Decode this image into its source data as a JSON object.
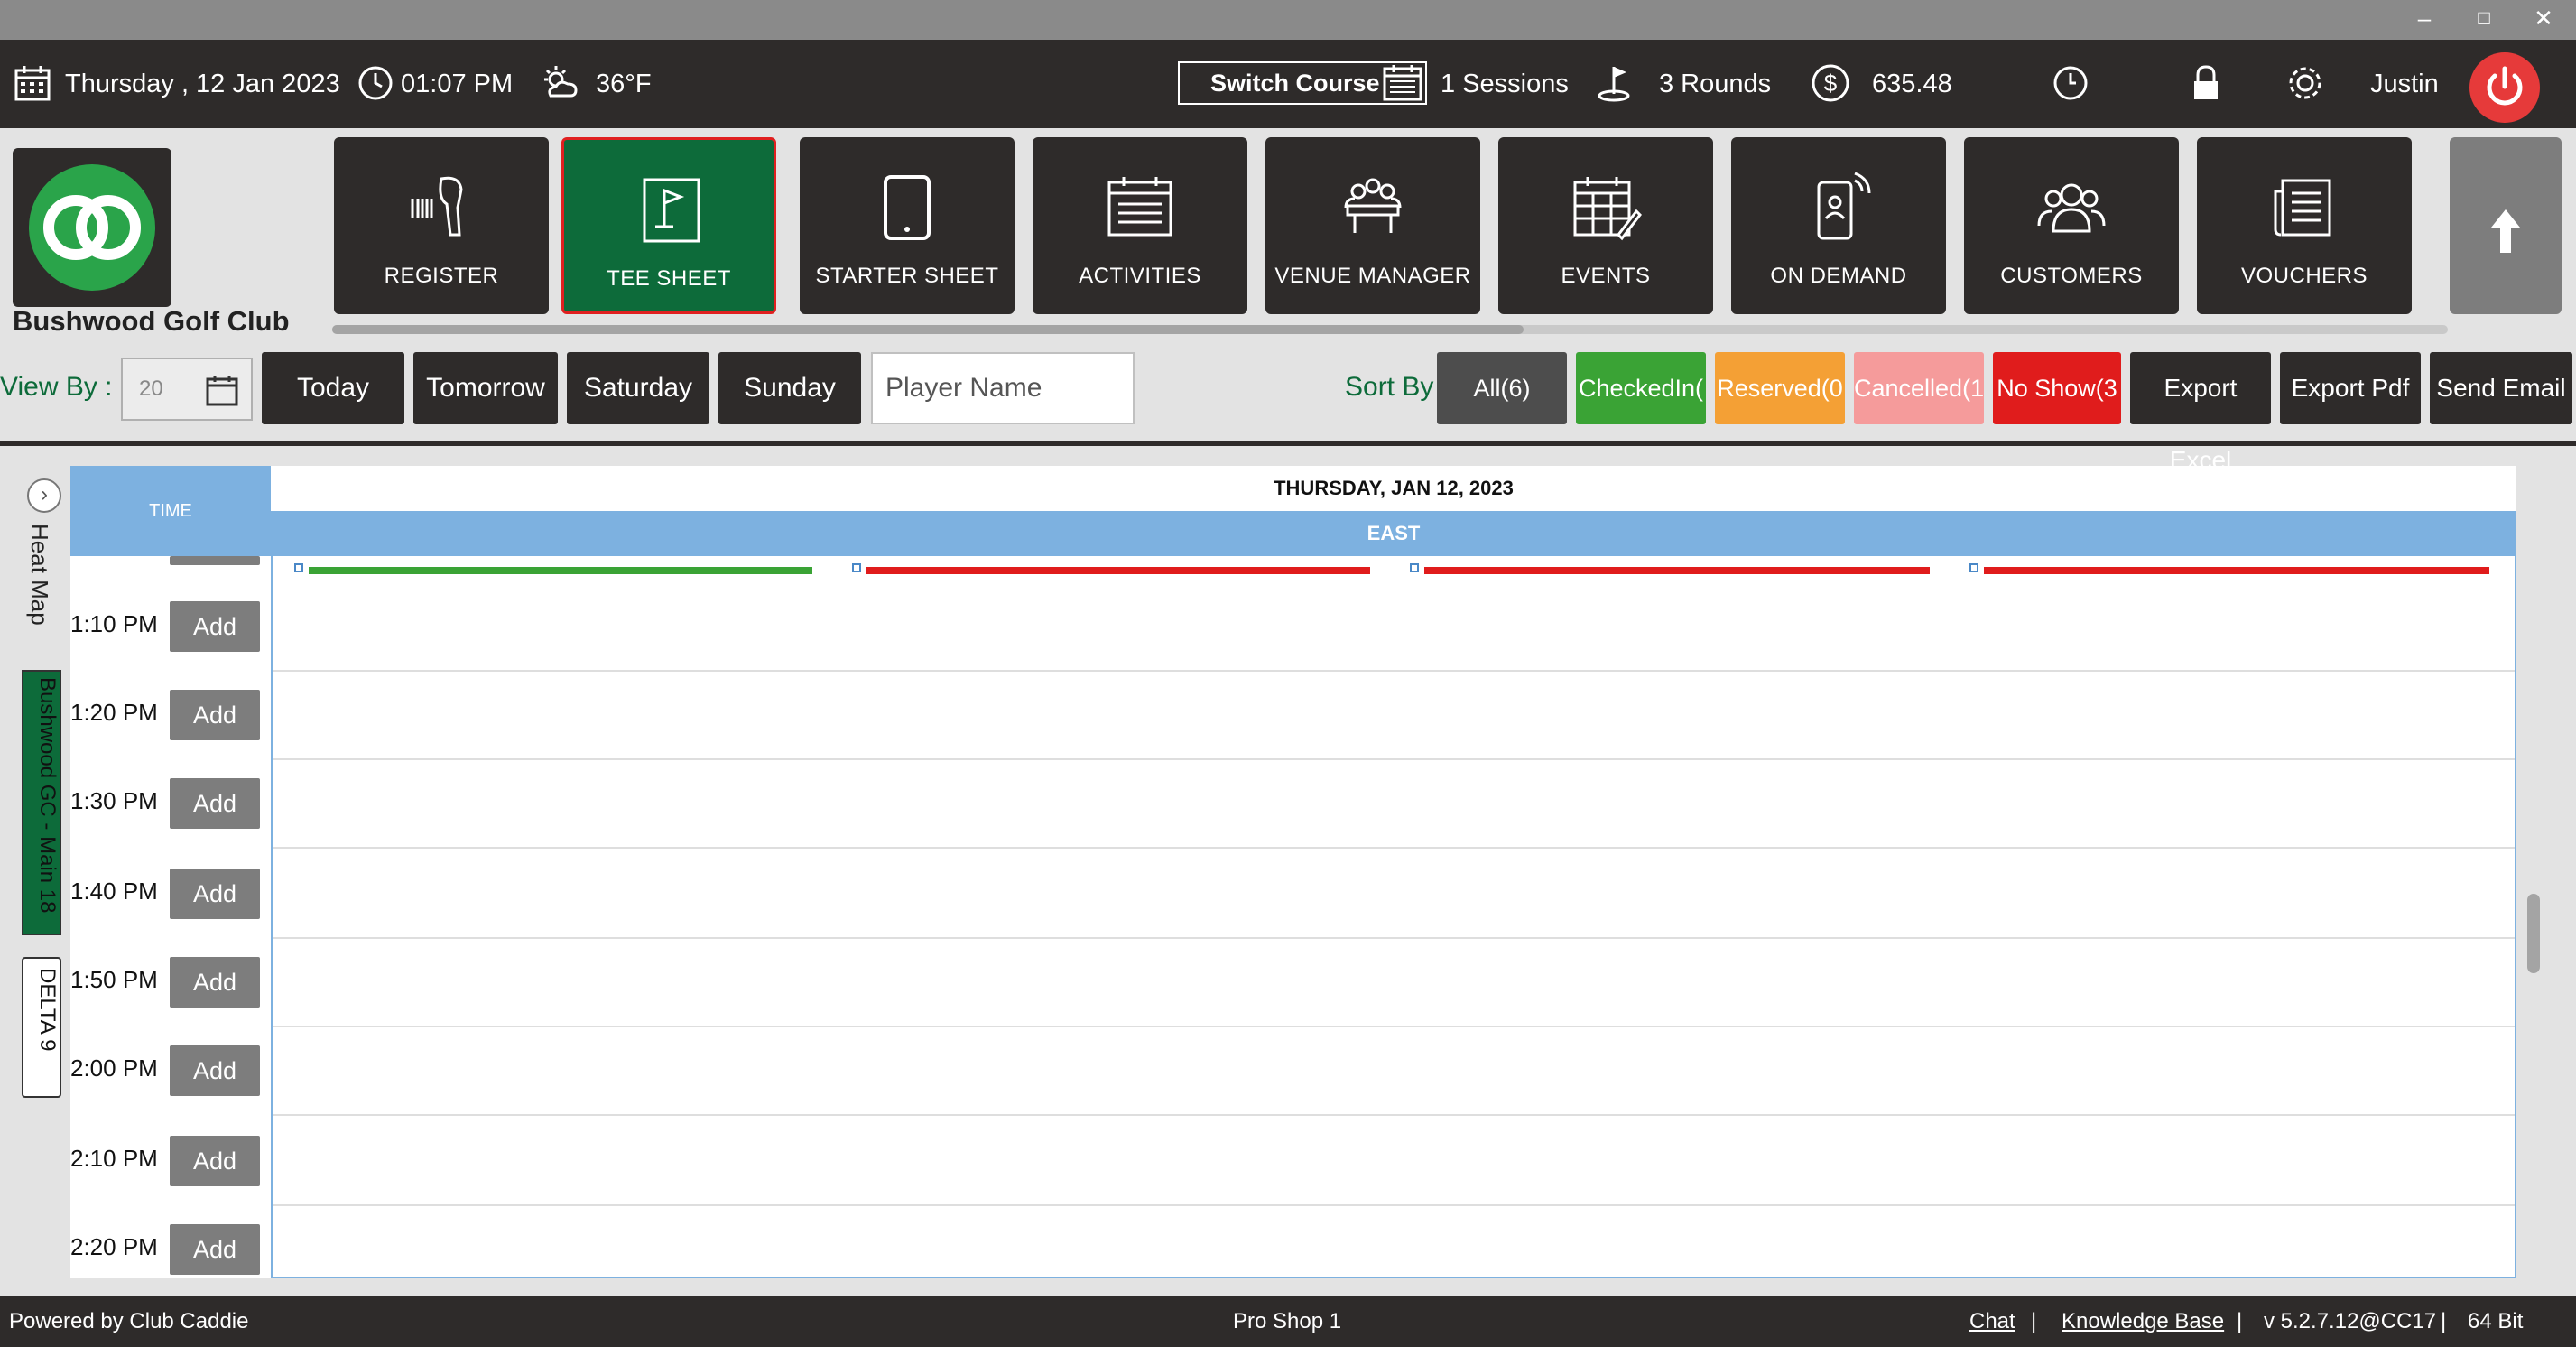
{
  "window": {
    "minimize": "–",
    "maximize": "□",
    "close": "✕"
  },
  "topbar": {
    "date": "Thursday ,  12 Jan 2023",
    "time": "01:07 PM",
    "weather": "36°F",
    "switch_course": "Switch Course",
    "sessions": "1 Sessions",
    "rounds": "3 Rounds",
    "balance": "635.48",
    "user": "Justin"
  },
  "club": {
    "name": "Bushwood Golf Club"
  },
  "nav": {
    "items": [
      {
        "label": "REGISTER",
        "icon": "barcode-scanner-icon"
      },
      {
        "label": "TEE SHEET",
        "icon": "tee-sheet-icon"
      },
      {
        "label": "STARTER SHEET",
        "icon": "tablet-icon"
      },
      {
        "label": "ACTIVITIES",
        "icon": "calendar-list-icon"
      },
      {
        "label": "VENUE MANAGER",
        "icon": "venue-table-icon"
      },
      {
        "label": "EVENTS",
        "icon": "events-calendar-icon"
      },
      {
        "label": "ON DEMAND",
        "icon": "phone-icon"
      },
      {
        "label": "CUSTOMERS",
        "icon": "people-icon"
      },
      {
        "label": "VOUCHERS",
        "icon": "voucher-icon"
      }
    ],
    "active": "TEE SHEET"
  },
  "filters": {
    "view_by": "View By :",
    "date_value": "20",
    "days": [
      "Today",
      "Tomorrow",
      "Saturday",
      "Sunday"
    ],
    "player_placeholder": "Player Name",
    "sort_by": "Sort By",
    "sort_buttons": [
      {
        "label": "All(6)",
        "color": "#4d4d4d"
      },
      {
        "label": "CheckedIn(",
        "color": "#3aa335"
      },
      {
        "label": "Reserved(0",
        "color": "#f4a035"
      },
      {
        "label": "Cancelled(1",
        "color": "#f59b9b"
      },
      {
        "label": "No Show(3",
        "color": "#e01c1c"
      }
    ],
    "export_excel": "Export Excel",
    "export_pdf": "Export Pdf",
    "send_email": "Send Email"
  },
  "sidebar": {
    "heat_map": "Heat Map",
    "course": "Bushwood GC - Main 18",
    "delta": "DELTA 9"
  },
  "grid": {
    "time_header": "TIME",
    "date_header": "THURSDAY, JAN 12, 2023",
    "course_header": "EAST",
    "status_bars": [
      "#3aa335",
      "#e01c1c",
      "#e01c1c",
      "#e01c1c"
    ],
    "add_label": "Add",
    "rows": [
      "1:10 PM",
      "1:20 PM",
      "1:30 PM",
      "1:40 PM",
      "1:50 PM",
      "2:00 PM",
      "2:10 PM",
      "2:20 PM"
    ]
  },
  "footer": {
    "powered": "Powered by Club Caddie",
    "terminal": "Pro Shop 1",
    "chat": "Chat",
    "sep": "|",
    "knowledge": "Knowledge Base",
    "version": "v 5.2.7.12@CC17",
    "bits": "64 Bit"
  }
}
